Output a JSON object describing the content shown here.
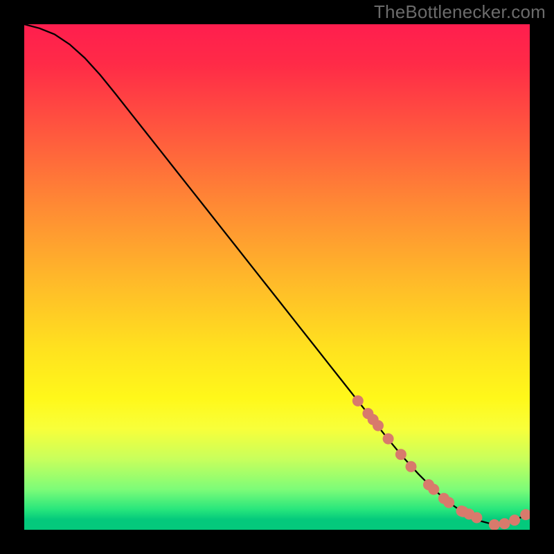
{
  "watermark": "TheBottlenecker.com",
  "colors": {
    "page_bg": "#000000",
    "curve": "#000000",
    "marker_fill": "#d87a6c",
    "marker_stroke": "#c06054"
  },
  "chart_data": {
    "type": "line",
    "title": "",
    "xlabel": "",
    "ylabel": "",
    "xlim": [
      0,
      100
    ],
    "ylim": [
      0,
      100
    ],
    "series": [
      {
        "name": "bottleneck-curve",
        "x": [
          0,
          3,
          6,
          9,
          12,
          15,
          18,
          21,
          24,
          27,
          30,
          33,
          36,
          39,
          42,
          45,
          48,
          51,
          54,
          57,
          60,
          63,
          66,
          69,
          72,
          75,
          78,
          81,
          84,
          87,
          90,
          93,
          95,
          97,
          100
        ],
        "y": [
          100.0,
          99.2,
          98.0,
          96.0,
          93.3,
          90.0,
          86.3,
          82.5,
          78.7,
          74.9,
          71.1,
          67.3,
          63.5,
          59.7,
          55.9,
          52.1,
          48.3,
          44.5,
          40.7,
          36.9,
          33.1,
          29.3,
          25.5,
          21.7,
          17.9,
          14.3,
          11.0,
          8.0,
          5.4,
          3.3,
          1.8,
          1.0,
          1.2,
          1.9,
          3.2
        ],
        "markers_x": [
          66,
          68,
          69,
          70,
          72,
          74.5,
          76.5,
          80,
          81,
          83,
          84,
          86.5,
          86.8,
          88,
          89.5,
          93,
          95,
          97,
          99.2
        ],
        "markers_y": [
          25.5,
          23.0,
          21.8,
          20.6,
          18.0,
          14.9,
          12.5,
          8.9,
          8.0,
          6.2,
          5.4,
          3.7,
          3.6,
          3.1,
          2.4,
          1.0,
          1.2,
          1.9,
          3.0
        ]
      }
    ],
    "annotations": []
  }
}
